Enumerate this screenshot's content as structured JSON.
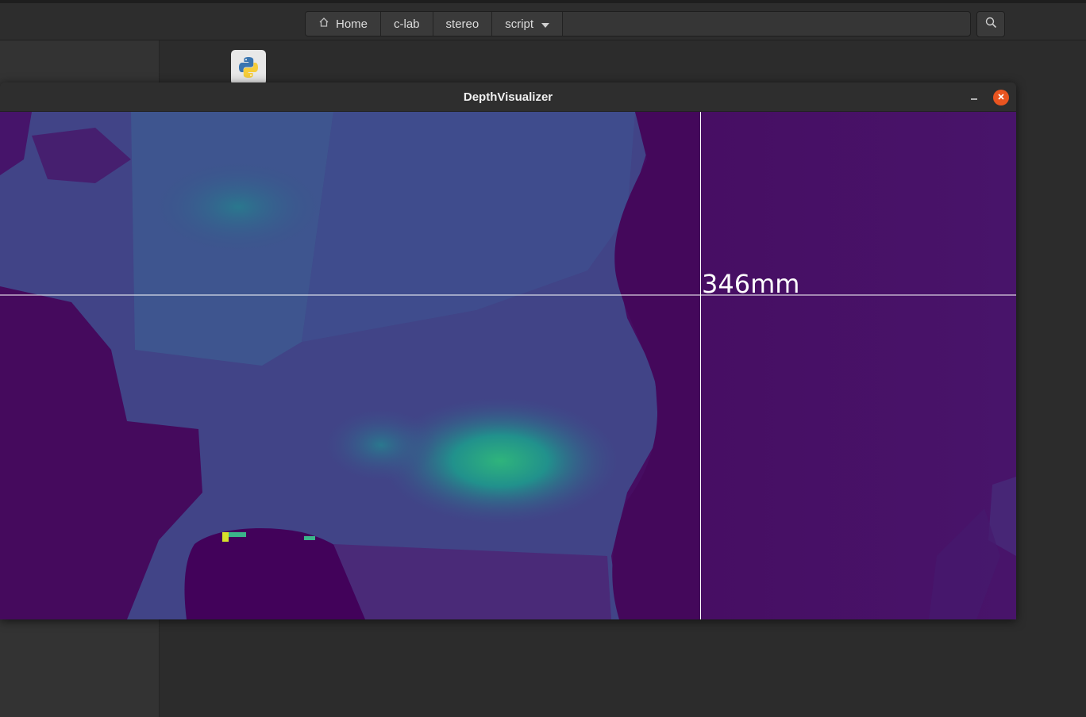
{
  "file_manager": {
    "breadcrumbs": [
      {
        "label": "Home",
        "icon": "home-icon"
      },
      {
        "label": "c-lab"
      },
      {
        "label": "stereo"
      },
      {
        "label": "script",
        "icon": "chevron-down-icon"
      }
    ],
    "search_icon": "search-icon",
    "file_icon": "python-file-icon"
  },
  "window": {
    "title": "DepthVisualizer",
    "minimize_icon": "minimize-icon",
    "close_icon": "close-icon",
    "close_color": "#e95420"
  },
  "depth_view": {
    "readout": "346mm",
    "colormap": "viridis",
    "crosshair_color": "#ffffff"
  }
}
